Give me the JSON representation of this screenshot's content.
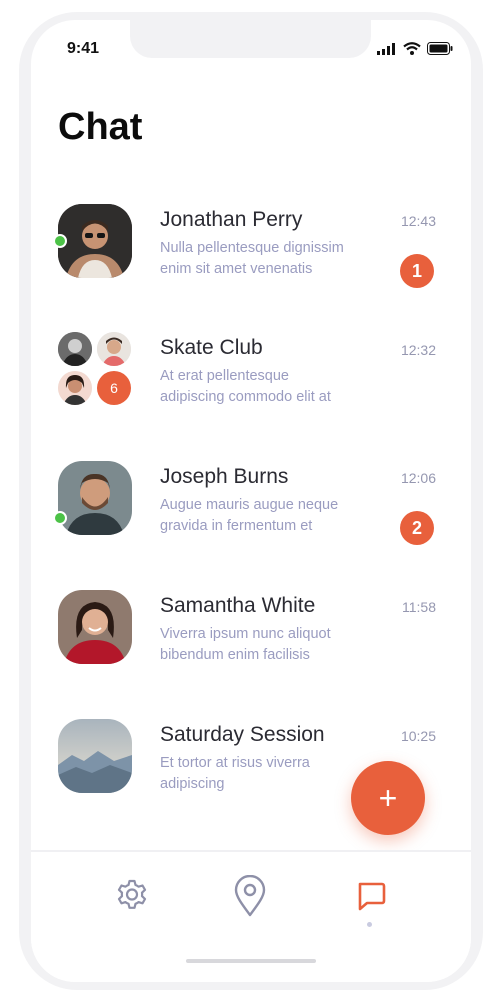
{
  "status": {
    "time": "9:41"
  },
  "title": "Chat",
  "chats": [
    {
      "name": "Jonathan Perry",
      "line1": "Nulla pellentesque dignissim",
      "line2": "enim sit amet venenatis",
      "time": "12:43",
      "unread": "1"
    },
    {
      "name": "Skate Club",
      "line1": "At erat pellentesque",
      "line2": "adipiscing commodo elit at",
      "time": "12:32",
      "members_more": "6"
    },
    {
      "name": "Joseph Burns",
      "line1": "Augue mauris augue neque",
      "line2": "gravida in fermentum et",
      "time": "12:06",
      "unread": "2"
    },
    {
      "name": "Samantha White",
      "line1": "Viverra ipsum nunc aliquot",
      "line2": "bibendum enim facilisis",
      "time": "11:58"
    },
    {
      "name": "Saturday Session",
      "line1": "Et tortor at risus viverra",
      "line2": "adipiscing",
      "time": "10:25"
    }
  ],
  "fab": {
    "label": "+"
  },
  "tabs": {
    "settings": "gear-icon",
    "location": "location-pin-icon",
    "chat": "chat-bubble-icon"
  },
  "colors": {
    "accent": "#e8603c",
    "online": "#4cc247",
    "secondary_text": "#9a9cc0"
  }
}
